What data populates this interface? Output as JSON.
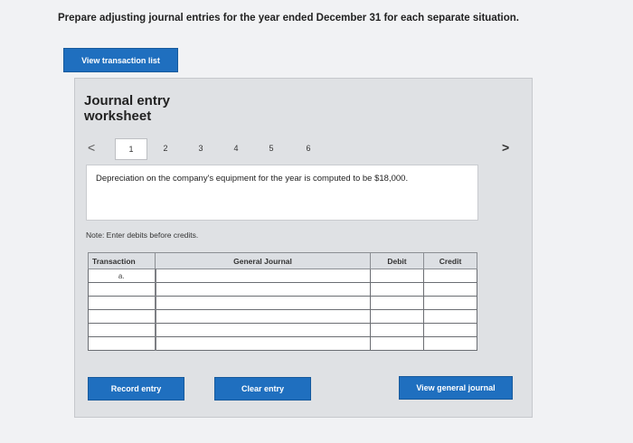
{
  "instruction": "Prepare adjusting journal entries for the year ended December 31 for each separate situation.",
  "view_transaction_list_label": "View transaction list",
  "worksheet": {
    "title": "Journal entry worksheet",
    "prev_arrow": "<",
    "next_arrow": ">",
    "pages": [
      "1",
      "2",
      "3",
      "4",
      "5",
      "6"
    ],
    "active_page": "1",
    "description": "Depreciation on the company's equipment for the year is computed to be $18,000.",
    "note": "Note: Enter debits before credits."
  },
  "table": {
    "headers": {
      "transaction": "Transaction",
      "general_journal": "General Journal",
      "debit": "Debit",
      "credit": "Credit"
    },
    "rows": [
      {
        "transaction": "a.",
        "account": "",
        "debit": "",
        "credit": ""
      },
      {
        "transaction": "",
        "account": "",
        "debit": "",
        "credit": ""
      },
      {
        "transaction": "",
        "account": "",
        "debit": "",
        "credit": ""
      },
      {
        "transaction": "",
        "account": "",
        "debit": "",
        "credit": ""
      },
      {
        "transaction": "",
        "account": "",
        "debit": "",
        "credit": ""
      },
      {
        "transaction": "",
        "account": "",
        "debit": "",
        "credit": ""
      }
    ]
  },
  "buttons": {
    "record_entry": "Record entry",
    "clear_entry": "Clear entry",
    "view_general_journal": "View general journal"
  },
  "colors": {
    "primary_button": "#1f6fbf",
    "page_background": "#f1f2f4",
    "worksheet_background": "#dfe1e4"
  }
}
